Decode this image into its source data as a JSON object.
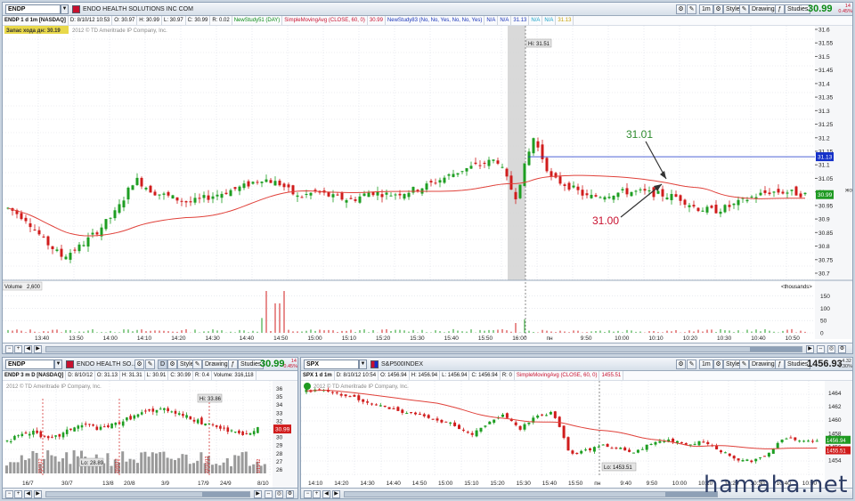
{
  "colors": {
    "up_candle": "#1e9e22",
    "down_candle": "#d01c1c",
    "sma_line": "#e0413a",
    "grid": "#d9dee6",
    "price_badge_green": "#1f9a22",
    "price_badge_blue": "#1430c8",
    "price_badge_red": "#d01c1c",
    "annotation_green": "#2e8b2e",
    "annotation_red": "#c8102e"
  },
  "main_panel": {
    "symbol": "ENDP",
    "company": "ENDO HEALTH SOLUTIONS INC COM",
    "toolbar": {
      "period": "1m",
      "style_label": "Style",
      "drawings_label": "Drawings",
      "studies_label": "Studies",
      "last_price": "30.99",
      "last_change_top": "14",
      "last_change_bottom": "0.45%"
    },
    "study_bar": [
      {
        "text": "ENDP 1 d 1m [NASDAQ]",
        "style": "head"
      },
      {
        "text": "D: 8/10/12 10:53",
        "style": ""
      },
      {
        "text": "O: 30.97",
        "style": ""
      },
      {
        "text": "H: 30.99",
        "style": ""
      },
      {
        "text": "L: 30.97",
        "style": ""
      },
      {
        "text": "C: 30.99",
        "style": ""
      },
      {
        "text": "R: 0.02",
        "style": ""
      },
      {
        "text": "NewStudy51 (DAY)",
        "style": "green"
      },
      {
        "text": "SimpleMovingAvg (CLOSE, 60, 0)",
        "style": "red"
      },
      {
        "text": "30.99",
        "style": "red"
      },
      {
        "text": "NewStudy83 (No, No, Yes, No, No, Yes)",
        "style": "blue"
      },
      {
        "text": "N/A",
        "style": "blue"
      },
      {
        "text": "N/A",
        "style": "blue"
      },
      {
        "text": "31.13",
        "style": "blue"
      },
      {
        "text": "N/A",
        "style": "cyan"
      },
      {
        "text": "N/A",
        "style": "cyan"
      },
      {
        "text": "31.13",
        "style": "yellow"
      }
    ],
    "yellow_label": "Запас хода дн: 30.19",
    "copyright": "2012 © TD Ameritrade IP Company, Inc.",
    "hi_label": "Hi: 31.51",
    "price_axis": [
      "31.6",
      "31.55",
      "31.5",
      "31.45",
      "31.4",
      "31.35",
      "31.3",
      "31.25",
      "31.2",
      "31.15",
      "31.1",
      "31.05",
      "31",
      "30.95",
      "30.9",
      "30.85",
      "30.8",
      "30.75",
      "30.7"
    ],
    "badge_blue": "31.13",
    "badge_green": "30.99",
    "annotation_up": "31.01",
    "annotation_down": "31.00",
    "edge_text": "жо",
    "volume_label": "Volume",
    "volume_value": "2,600",
    "volume_units": "<thousands>",
    "volume_axis": [
      "150",
      "100",
      "50",
      "0"
    ],
    "time_axis": [
      "13:40",
      "13:50",
      "14:00",
      "14:10",
      "14:20",
      "14:30",
      "14:40",
      "14:50",
      "15:00",
      "15:10",
      "15:20",
      "15:30",
      "15:40",
      "15:50",
      "16:00",
      "пн",
      "9:50",
      "10:00",
      "10:10",
      "10:20",
      "10:30",
      "10:40",
      "10:50"
    ]
  },
  "left_panel": {
    "symbol": "ENDP",
    "company": "ENDO HEALTH SO...",
    "toolbar": {
      "period": "D",
      "style_label": "Style",
      "drawings_label": "Drawings",
      "studies_label": "Studies",
      "last_price": "30.99",
      "last_change_top": "14",
      "last_change_bottom": "0.45%"
    },
    "study_bar": [
      {
        "text": "ENDP 3 m D [NASDAQ]",
        "style": "head"
      },
      {
        "text": "D: 8/10/12",
        "style": ""
      },
      {
        "text": "O: 31.13",
        "style": ""
      },
      {
        "text": "H: 31.31",
        "style": ""
      },
      {
        "text": "L: 30.91",
        "style": ""
      },
      {
        "text": "C: 30.99",
        "style": ""
      },
      {
        "text": "R: 0.4",
        "style": ""
      },
      {
        "text": "Volume: 316,118",
        "style": ""
      }
    ],
    "copyright": "2012 © TD Ameritrade IP Company, Inc.",
    "hi_label": "Hi: 33.86",
    "lo_label": "Lo: 28.89",
    "price_axis": [
      "36",
      "35",
      "34",
      "33",
      "32",
      "31",
      "30",
      "29",
      "28",
      "27",
      "26"
    ],
    "badge_red": "30.99",
    "time_axis": [
      "16/7",
      "30/7",
      "13/8",
      "20/8",
      "3/9",
      "17/9",
      "24/9",
      "8/10"
    ],
    "event_labels": [
      "23/7/12",
      "20/8/12",
      "22/10/12",
      "1/11/12"
    ]
  },
  "right_panel": {
    "symbol": "SPX",
    "company": "S&P500INDEX",
    "toolbar": {
      "period": "1m",
      "style_label": "Style",
      "drawings_label": "Drawings",
      "studies_label": "Studies",
      "last_price": "1456.93",
      "last_change_top": "4.32",
      "last_change_bottom": "0.30%"
    },
    "study_bar": [
      {
        "text": "SPX 1 d 1m",
        "style": "head"
      },
      {
        "text": "D: 8/10/12 10:54",
        "style": ""
      },
      {
        "text": "O: 1456.94",
        "style": ""
      },
      {
        "text": "H: 1456.94",
        "style": ""
      },
      {
        "text": "L: 1456.94",
        "style": ""
      },
      {
        "text": "C: 1456.94",
        "style": ""
      },
      {
        "text": "R: 0",
        "style": ""
      },
      {
        "text": "SimpleMovingAvg (CLOSE, 60, 0)",
        "style": "red"
      },
      {
        "text": "1455.51",
        "style": "red"
      }
    ],
    "copyright": "2012 © TD Ameritrade IP Company, Inc.",
    "lo_label": "Lo: 1453.51",
    "price_axis": [
      "1464",
      "1462",
      "1460",
      "1458",
      "1456",
      "1454"
    ],
    "badge_green": "1456.94",
    "badge_red": "1455.51",
    "time_axis": [
      "14:10",
      "14:20",
      "14:30",
      "14:40",
      "14:50",
      "15:00",
      "15:10",
      "15:20",
      "15:30",
      "15:40",
      "15:50",
      "пн",
      "9:40",
      "9:50",
      "10:00",
      "10:10",
      "10:20",
      "10:30",
      "10:40",
      "10:50"
    ]
  },
  "watermark": "hamaha.net"
}
